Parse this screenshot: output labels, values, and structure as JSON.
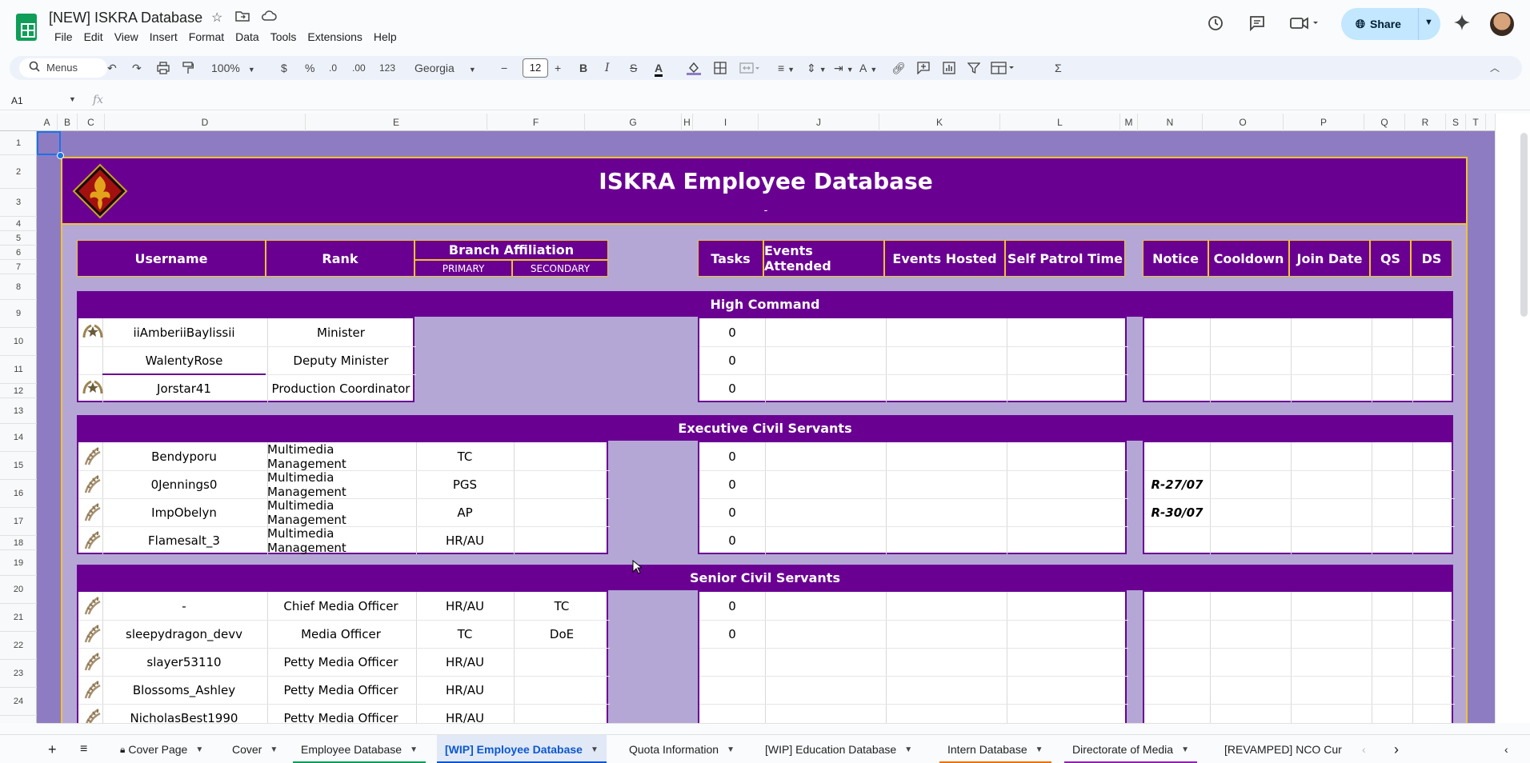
{
  "app": {
    "doc_title": "[NEW] ISKRA Database",
    "menu": [
      "File",
      "Edit",
      "View",
      "Insert",
      "Format",
      "Data",
      "Tools",
      "Extensions",
      "Help"
    ],
    "share_label": "Share"
  },
  "toolbar": {
    "menus_label": "Menus",
    "zoom": "100%",
    "currency": "$",
    "percent": "%",
    "dec_decrease": ".0",
    "dec_increase": ".00",
    "number_format": "123",
    "font": "Georgia",
    "font_size": "12",
    "minus": "−",
    "plus": "+",
    "bold": "B",
    "italic": "I",
    "strike": "S",
    "text_color": "A",
    "sigma": "Σ"
  },
  "formula_bar": {
    "name_box": "A1",
    "fx": "fx",
    "value": ""
  },
  "columns": [
    "A",
    "B",
    "C",
    "D",
    "E",
    "F",
    "G",
    "H",
    "I",
    "J",
    "K",
    "L",
    "M",
    "N",
    "O",
    "P",
    "Q",
    "R",
    "S",
    "T"
  ],
  "rows": [
    "1",
    "2",
    "3",
    "4",
    "5",
    "6",
    "7",
    "8",
    "9",
    "10",
    "11",
    "12",
    "13",
    "14",
    "15",
    "16",
    "17",
    "18",
    "19",
    "20",
    "21",
    "22",
    "23",
    "24"
  ],
  "sheet": {
    "title": "ISKRA Employee Database",
    "subtitle": "-",
    "headers": {
      "username": "Username",
      "rank": "Rank",
      "branch": "Branch Affiliation",
      "primary": "PRIMARY",
      "secondary": "SECONDARY",
      "tasks": "Tasks",
      "events_attended": "Events Attended",
      "events_hosted": "Events Hosted",
      "self_patrol": "Self Patrol Time",
      "notice": "Notice",
      "cooldown": "Cooldown",
      "join_date": "Join Date",
      "qs": "QS",
      "ds": "DS"
    },
    "sections": {
      "high_command": "High Command",
      "executive": "Executive Civil Servants",
      "senior": "Senior Civil Servants"
    },
    "high_command": [
      {
        "username": "iiAmberiiBaylissii",
        "rank": "Minister",
        "tasks": "0"
      },
      {
        "username": "WalentyRose",
        "rank": "Deputy Minister",
        "tasks": "0"
      },
      {
        "username": "Jorstar41",
        "rank": "Production Coordinator",
        "tasks": "0"
      }
    ],
    "executive": [
      {
        "username": "Bendyporu",
        "rank": "Multimedia Management",
        "primary": "TC",
        "tasks": "0",
        "notice": ""
      },
      {
        "username": "0Jennings0",
        "rank": "Multimedia Management",
        "primary": "PGS",
        "tasks": "0",
        "notice": "R-27/07"
      },
      {
        "username": "ImpObelyn",
        "rank": "Multimedia Management",
        "primary": "AP",
        "tasks": "0",
        "notice": "R-30/07"
      },
      {
        "username": "Flamesalt_3",
        "rank": "Multimedia Management",
        "primary": "HR/AU",
        "tasks": "0",
        "notice": ""
      }
    ],
    "senior": [
      {
        "username": "-",
        "rank": "Chief Media Officer",
        "primary": "HR/AU",
        "secondary": "TC",
        "tasks": "0"
      },
      {
        "username": "sleepydragon_devv",
        "rank": "Media Officer",
        "primary": "TC",
        "secondary": "DoE",
        "tasks": "0"
      },
      {
        "username": "slayer53110",
        "rank": "Petty Media Officer",
        "primary": "HR/AU",
        "secondary": "",
        "tasks": ""
      },
      {
        "username": "Blossoms_Ashley",
        "rank": "Petty Media Officer",
        "primary": "HR/AU",
        "secondary": "",
        "tasks": ""
      },
      {
        "username": "NicholasBest1990",
        "rank": "Petty Media Officer",
        "primary": "HR/AU",
        "secondary": "",
        "tasks": ""
      }
    ]
  },
  "tabs": [
    {
      "label": "Cover Page",
      "locked": true
    },
    {
      "label": "Cover"
    },
    {
      "label": "Employee Database"
    },
    {
      "label": "[WIP] Employee Database",
      "active": true
    },
    {
      "label": "Quota Information"
    },
    {
      "label": "[WIP] Education Database"
    },
    {
      "label": "Intern Database"
    },
    {
      "label": "Directorate of Media"
    },
    {
      "label": "[REVAMPED] NCO Cur"
    }
  ],
  "colors": {
    "purple": "#6a0092",
    "lavender": "#b4a7d6",
    "bg_purple": "#8e7cc3",
    "gold": "#f1c232",
    "accent_blue": "#1a73e8"
  }
}
